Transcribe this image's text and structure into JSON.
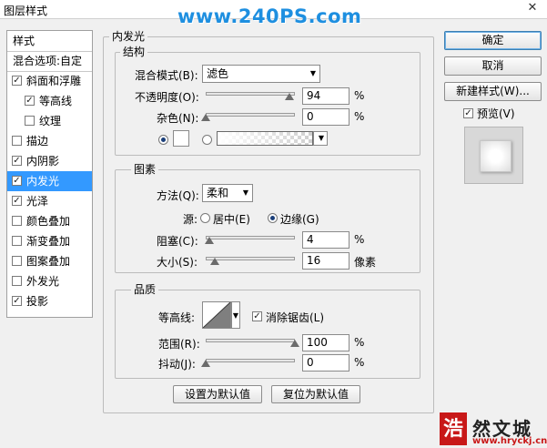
{
  "window": {
    "title": "图层样式",
    "close_glyph": "✕"
  },
  "watermark": "www.240PS.com",
  "left_panel": {
    "header": "样式",
    "blend_options": "混合选项:自定",
    "items": [
      {
        "label": "斜面和浮雕",
        "checked": true
      },
      {
        "label": "等高线",
        "checked": true
      },
      {
        "label": "纹理",
        "checked": false
      },
      {
        "label": "描边",
        "checked": false
      },
      {
        "label": "内阴影",
        "checked": true
      },
      {
        "label": "内发光",
        "checked": true,
        "selected": true
      },
      {
        "label": "光泽",
        "checked": true
      },
      {
        "label": "颜色叠加",
        "checked": false
      },
      {
        "label": "渐变叠加",
        "checked": false
      },
      {
        "label": "图案叠加",
        "checked": false
      },
      {
        "label": "外发光",
        "checked": false
      },
      {
        "label": "投影",
        "checked": true
      }
    ]
  },
  "main": {
    "section_title": "内发光",
    "structure": {
      "title": "结构",
      "blend_mode_label": "混合模式(B):",
      "blend_mode_value": "滤色",
      "opacity_label": "不透明度(O):",
      "opacity_value": "94",
      "opacity_unit": "%",
      "noise_label": "杂色(N):",
      "noise_value": "0",
      "noise_unit": "%"
    },
    "elements": {
      "title": "图素",
      "method_label": "方法(Q):",
      "method_value": "柔和",
      "source_label": "源:",
      "source_center": "居中(E)",
      "source_edge": "边缘(G)",
      "choke_label": "阻塞(C):",
      "choke_value": "4",
      "choke_unit": "%",
      "size_label": "大小(S):",
      "size_value": "16",
      "size_unit": "像素"
    },
    "quality": {
      "title": "品质",
      "contour_label": "等高线:",
      "antialias_label": "消除锯齿(L)",
      "antialias_checked": true,
      "range_label": "范围(R):",
      "range_value": "100",
      "range_unit": "%",
      "jitter_label": "抖动(J):",
      "jitter_value": "0",
      "jitter_unit": "%"
    },
    "set_default": "设置为默认值",
    "reset_default": "复位为默认值"
  },
  "right": {
    "ok": "确定",
    "cancel": "取消",
    "new_style": "新建样式(W)...",
    "preview_label": "预览(V)",
    "preview_checked": true
  },
  "slider_levels": {
    "opacity": 0.94,
    "noise": 0.0,
    "choke": 0.04,
    "size": 0.1,
    "range": 1.0,
    "jitter": 0.0
  },
  "logo": {
    "seal": "浩",
    "text": "然文城",
    "url": "www.hryckj.cn"
  },
  "colors": {
    "selection": "#3399ff",
    "watermark": "#1e8fe0",
    "logo_red": "#c81818"
  }
}
